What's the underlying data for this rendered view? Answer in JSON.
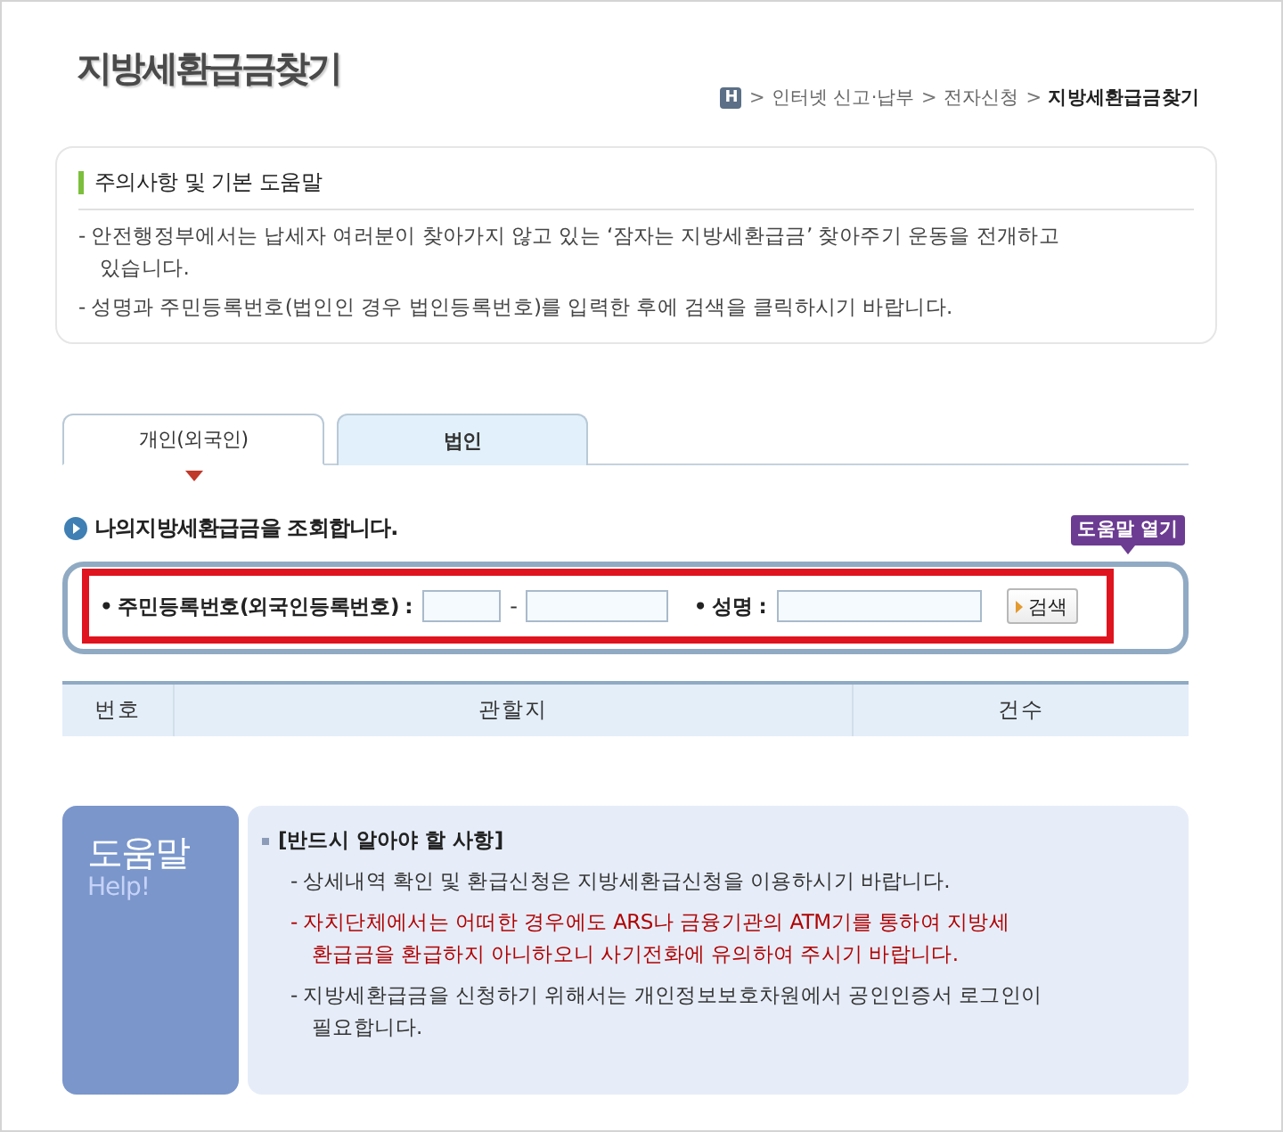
{
  "page_title": "지방세환급금찾기",
  "breadcrumb": {
    "home": "H",
    "items": [
      {
        "separator": ">",
        "label": "인터넷 신고·납부",
        "current": false
      },
      {
        "separator": ">",
        "label": "전자신청",
        "current": false
      },
      {
        "separator": ">",
        "label": "지방세환급금찾기",
        "current": true
      }
    ]
  },
  "notice": {
    "title": "주의사항 및 기본 도움말",
    "items": [
      "- 안전행정부에서는 납세자 여러분이 찾아가지 않고 있는 ‘잠자는 지방세환급금’ 찾아주기 운동을 전개하고 있습니다.",
      "- 성명과 주민등록번호(법인인 경우 법인등록번호)를 입력한 후에 검색을 클릭하시기 바랍니다."
    ]
  },
  "tabs": [
    {
      "label": "개인(외국인)",
      "selected": true
    },
    {
      "label": "법인",
      "selected": false
    }
  ],
  "lookup": {
    "heading": "나의지방세환급금을 조회합니다.",
    "help_button": "도움말 열기",
    "id_label": "• 주민등록번호(외국인등록번호) :",
    "id_separator": "-",
    "name_label": "• 성명 :",
    "search_button": "검색"
  },
  "table": {
    "columns": [
      "번호",
      "관할지",
      "건수"
    ]
  },
  "help": {
    "title": "도움말",
    "subtitle": "Help!",
    "heading": "[반드시 알아야 할 사항]",
    "items": [
      {
        "kind": "normal",
        "text": "- 상세내역 확인 및 환급신청은 지방세환급신청을 이용하시기 바랍니다."
      },
      {
        "kind": "warning",
        "text": "- 자치단체에서는 어떠한 경우에도 ARS나 금융기관의 ATM기를 통하여 지방세 환급금을 환급하지 아니하오니 사기전화에 유의하여 주시기 바랍니다."
      },
      {
        "kind": "normal",
        "text": "- 지방세환급금을 신청하기 위해서는 개인정보보호차원에서 공인인증서 로그인이 필요합니다."
      }
    ]
  }
}
